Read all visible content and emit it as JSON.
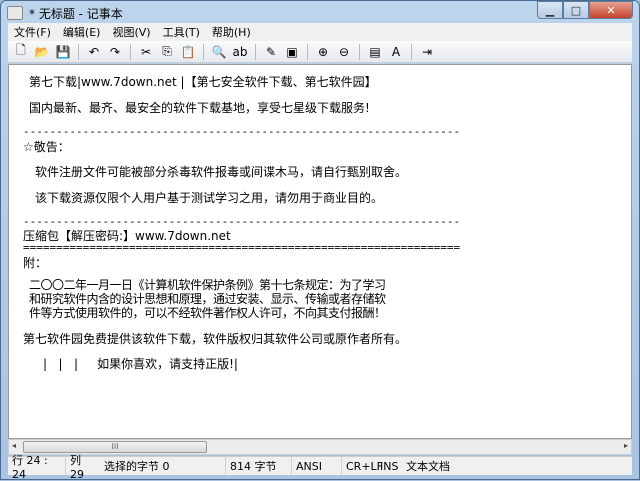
{
  "window": {
    "title": "* 无标题 - 记事本"
  },
  "menu": [
    "文件(F)",
    "编辑(E)",
    "视图(V)",
    "工具(T)",
    "帮助(H)"
  ],
  "toolbar": [
    [
      "new-icon",
      "🗋"
    ],
    [
      "open-icon",
      "📂"
    ],
    [
      "save-icon",
      "💾"
    ],
    [
      "sep",
      ""
    ],
    [
      "undo-icon",
      "↶"
    ],
    [
      "redo-icon",
      "↷"
    ],
    [
      "sep",
      ""
    ],
    [
      "cut-icon",
      "✂"
    ],
    [
      "copy-icon",
      "⎘"
    ],
    [
      "paste-icon",
      "📋"
    ],
    [
      "sep",
      ""
    ],
    [
      "find-icon",
      "🔍"
    ],
    [
      "replace-icon",
      "ab"
    ],
    [
      "sep",
      ""
    ],
    [
      "goto-icon",
      "✎"
    ],
    [
      "insert-icon",
      "▣"
    ],
    [
      "sep",
      ""
    ],
    [
      "zoom-in-icon",
      "⊕"
    ],
    [
      "zoom-out-icon",
      "⊖"
    ],
    [
      "sep",
      ""
    ],
    [
      "wordwrap-icon",
      "▤"
    ],
    [
      "font-icon",
      "A"
    ],
    [
      "sep",
      ""
    ],
    [
      "exit-icon",
      "⇥"
    ]
  ],
  "lines": [
    "第七下载|www.7down.net |【第七安全软件下载、第七软件园】",
    "国内最新、最齐、最安全的软件下载基地，享受七星级下载服务!",
    "------------------------------------------------------------------",
    "☆敬告：",
    "软件注册文件可能被部分杀毒软件报毒或间谍木马，请自行甄别取舍。",
    "该下载资源仅限个人用户基于测试学习之用，请勿用于商业目的。",
    "------------------------------------------------------------------",
    "压缩包【解压密码:】www.7down.net",
    "==================================================================",
    "附：",
    "二〇〇二年一月一日《计算机软件保护条例》第十七条规定：为了学习",
    "和研究软件内含的设计思想和原理，通过安装、显示、传输或者存储软",
    "件等方式使用软件的，可以不经软件著作权人许可，不向其支付报酬！",
    "第七软件园免费提供该软件下载，软件版权归其软件公司或原作者所有。",
    "|   |   |     如果你喜欢，请支持正版!|"
  ],
  "status": {
    "pos": "行 24 : 24",
    "col": "列 29",
    "sel": "选择的字节 0",
    "size": "814 字节",
    "enc": "ANSI",
    "eol": "CR+LF",
    "mode": "INS",
    "type": "文本文档"
  }
}
